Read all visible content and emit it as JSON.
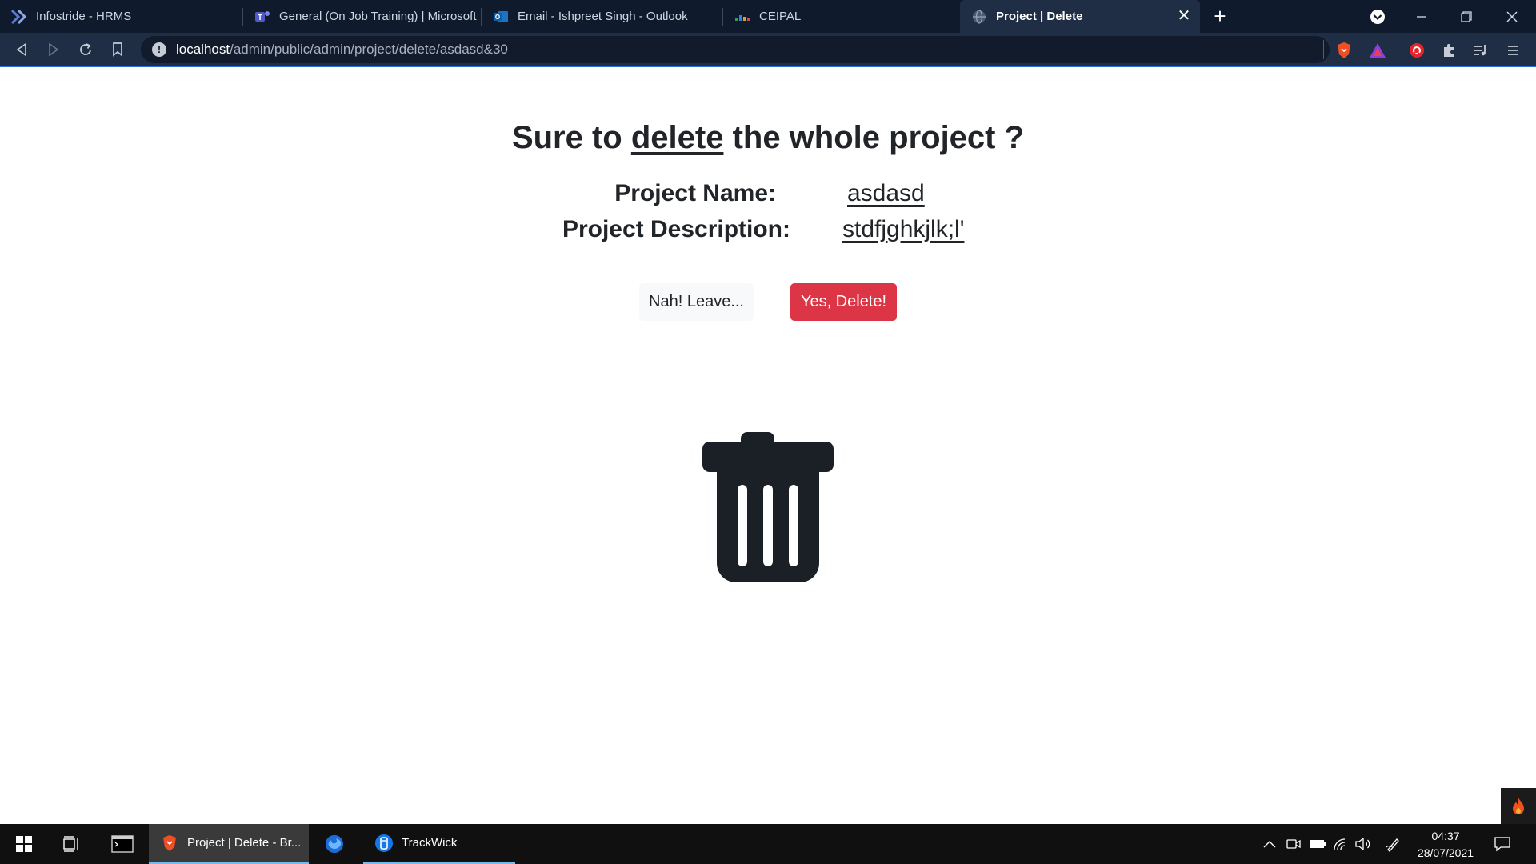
{
  "browser": {
    "tabs": [
      {
        "label": "Infostride - HRMS",
        "icon": "infostride-icon",
        "active": false
      },
      {
        "label": "General (On Job Training) | Microsoft T",
        "icon": "teams-icon",
        "active": false
      },
      {
        "label": "Email - Ishpreet Singh - Outlook",
        "icon": "outlook-icon",
        "active": false
      },
      {
        "label": "CEIPAL",
        "icon": "ceipal-icon",
        "active": false
      },
      {
        "label": "Project | Delete",
        "icon": "globe-icon",
        "active": true
      }
    ],
    "close_tab_glyph": "✕",
    "new_tab_glyph": "+",
    "url_host": "localhost",
    "url_path": "/admin/public/admin/project/delete/asdasd&30",
    "info_glyph": "!"
  },
  "page": {
    "heading_before": "Sure to ",
    "heading_emphasis": "delete",
    "heading_after": " the whole project ?",
    "project_name_label": "Project Name:",
    "project_name_value": "asdasd",
    "project_description_label": "Project Description:",
    "project_description_value": "stdfjghkjlk;l'",
    "leave_button": "Nah! Leave...",
    "delete_button": "Yes, Delete!",
    "illustration_icon": "trash-can-icon",
    "accent_color": "#dc3545"
  },
  "taskbar": {
    "apps": [
      {
        "label": "Project | Delete - Br...",
        "icon": "brave-icon",
        "state": "active"
      },
      {
        "label": "",
        "icon": "firefox-icon",
        "state": "pinned"
      },
      {
        "label": "TrackWick",
        "icon": "trackwick-icon",
        "state": "running"
      }
    ],
    "time": "04:37",
    "date": "28/07/2021"
  }
}
